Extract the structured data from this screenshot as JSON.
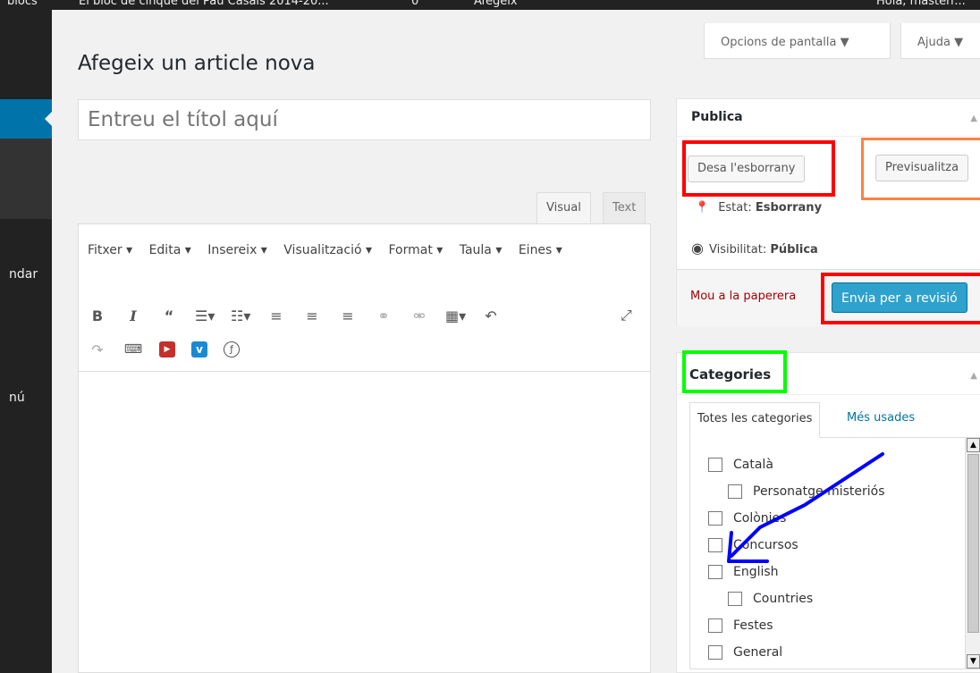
{
  "admin_bar": {
    "site_link": "blocs",
    "site_name": "El bloc de cinque del Pau Casals 2014-20...",
    "comments_count": "0",
    "new_label": "Afegeix",
    "greeting": "Hola, masterr..."
  },
  "sidebar": {
    "items": [
      {
        "label": "ndar"
      },
      {
        "label": "nú"
      }
    ]
  },
  "screen_meta": {
    "options_label": "Opcions de pantalla ▼",
    "help_label": "Ajuda ▼"
  },
  "page_title": "Afegeix un article nova",
  "title_input": {
    "placeholder": "Entreu el títol aquí"
  },
  "editor": {
    "tabs": {
      "visual": "Visual",
      "text": "Text"
    },
    "menus": [
      "Fitxer ▾",
      "Edita ▾",
      "Insereix ▾",
      "Visualització ▾",
      "Format ▾",
      "Taula ▾",
      "Eines ▾"
    ],
    "toolbar_icons": [
      "bold-icon",
      "italic-icon",
      "blockquote-icon",
      "bullet-list-icon",
      "numbered-list-icon",
      "align-left-icon",
      "align-center-icon",
      "align-right-icon",
      "link-icon",
      "unlink-icon",
      "table-icon",
      "undo-icon",
      "fullscreen-icon",
      "redo-icon",
      "keyboard-icon",
      "youtube-icon",
      "vimeo-icon",
      "flash-icon"
    ]
  },
  "publish_box": {
    "title": "Publica",
    "save_draft": "Desa l'esborrany",
    "preview": "Previsualitza",
    "status_label": "Estat:",
    "status_value": "Esborrany",
    "visibility_label": "Visibilitat:",
    "visibility_value": "Pública",
    "trash": "Mou a la paperera",
    "submit": "Envia per a revisió"
  },
  "categories_box": {
    "title": "Categories",
    "tabs": {
      "all": "Totes les categories",
      "popular": "Més usades"
    },
    "items": [
      {
        "label": "Català",
        "level": 0
      },
      {
        "label": "Personatge misteriós",
        "level": 1
      },
      {
        "label": "Colònies",
        "level": 0
      },
      {
        "label": "Concursos",
        "level": 0
      },
      {
        "label": "English",
        "level": 0
      },
      {
        "label": "Countries",
        "level": 1
      },
      {
        "label": "Festes",
        "level": 0
      },
      {
        "label": "General",
        "level": 0
      }
    ]
  },
  "annotation_colors": {
    "red": "#ff0000",
    "orange": "#ff8040",
    "green": "#00ff00",
    "blue": "#0000ff"
  }
}
